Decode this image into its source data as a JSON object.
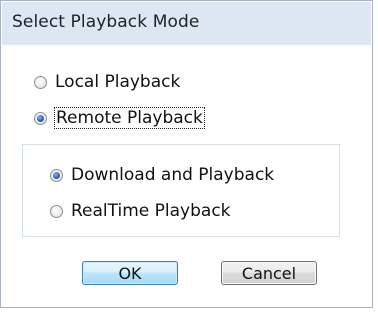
{
  "dialog": {
    "title": "Select Playback Mode"
  },
  "mode": {
    "options": [
      {
        "label": "Local Playback",
        "checked": false
      },
      {
        "label": "Remote Playback",
        "checked": true
      }
    ]
  },
  "remote_mode": {
    "options": [
      {
        "label": "Download and Playback",
        "checked": true
      },
      {
        "label": "RealTime Playback",
        "checked": false
      }
    ]
  },
  "buttons": {
    "ok_label": "OK",
    "cancel_label": "Cancel"
  },
  "colors": {
    "title_bar_bg": "#dce7f3",
    "dialog_border": "#a9b3bf",
    "radio_checked": "#2b66b8",
    "ok_button_border": "#3c7fb1"
  }
}
